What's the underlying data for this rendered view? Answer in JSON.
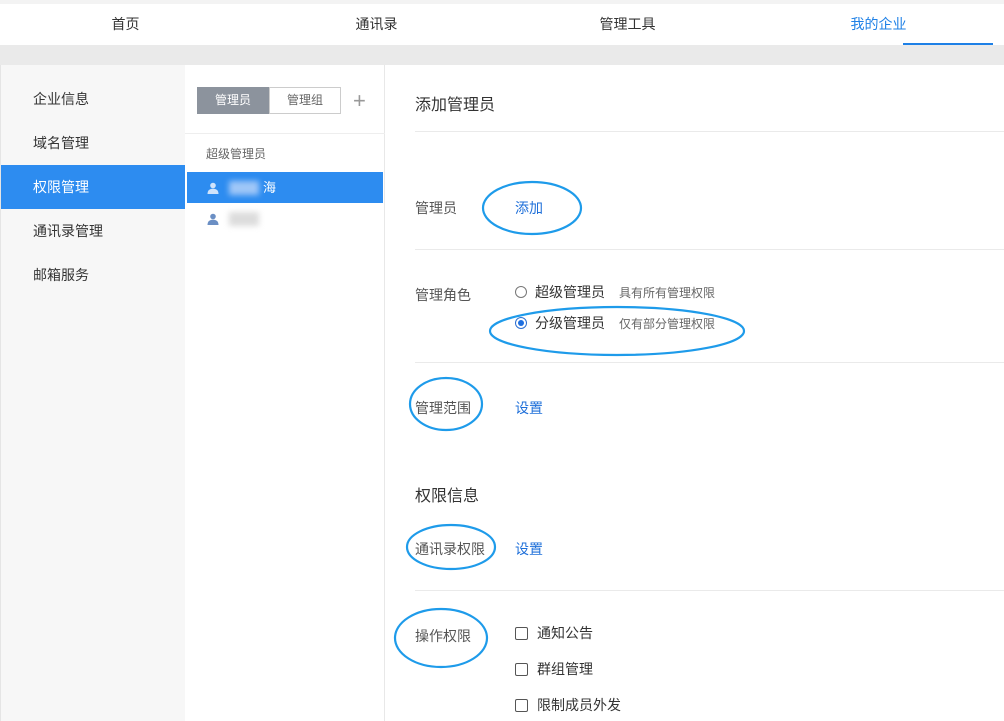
{
  "topnav": {
    "tabs": [
      {
        "label": "首页"
      },
      {
        "label": "通讯录"
      },
      {
        "label": "管理工具"
      },
      {
        "label": "我的企业"
      }
    ]
  },
  "sidebar": {
    "items": [
      {
        "label": "企业信息"
      },
      {
        "label": "域名管理"
      },
      {
        "label": "权限管理"
      },
      {
        "label": "通讯录管理"
      },
      {
        "label": "邮箱服务"
      }
    ]
  },
  "admin_panel": {
    "segments": [
      "管理员",
      "管理组"
    ],
    "add_symbol": "+",
    "group_label": "超级管理员",
    "admins": [
      {
        "name_tail": "海"
      },
      {
        "name_tail": ""
      }
    ]
  },
  "main": {
    "add_title": "添加管理员",
    "admin_label": "管理员",
    "admin_add_link": "添加",
    "role_label": "管理角色",
    "roles": [
      {
        "name": "超级管理员",
        "desc": "具有所有管理权限"
      },
      {
        "name": "分级管理员",
        "desc": "仅有部分管理权限"
      }
    ],
    "scope_label": "管理范围",
    "scope_link": "设置",
    "perm_title": "权限信息",
    "contacts_perm_label": "通讯录权限",
    "contacts_perm_link": "设置",
    "op_perm_label": "操作权限",
    "op_perms": [
      {
        "label": "通知公告"
      },
      {
        "label": "群组管理"
      },
      {
        "label": "限制成员外发"
      }
    ]
  },
  "colors": {
    "accent": "#2d8cf0",
    "annotation": "#1e9bea"
  }
}
